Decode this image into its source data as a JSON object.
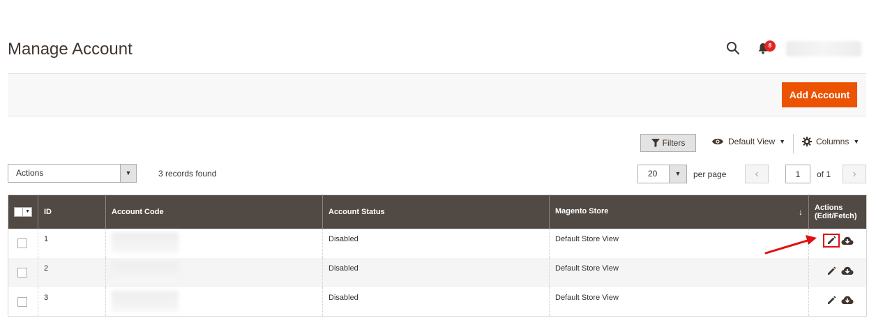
{
  "page": {
    "title": "Manage Account"
  },
  "header": {
    "notifications_count": "8",
    "search_icon": "search-icon",
    "bell_icon": "bell-icon"
  },
  "toolbar": {
    "add_button": "Add Account"
  },
  "grid_controls": {
    "filters_label": "Filters",
    "view_label": "Default View",
    "columns_label": "Columns",
    "actions_select": "Actions",
    "records_found": "3 records found",
    "page_size": "20",
    "per_page_label": "per page",
    "current_page": "1",
    "of_pages": "of 1"
  },
  "table": {
    "headers": {
      "id": "ID",
      "account_code": "Account Code",
      "account_status": "Account Status",
      "magento_store": "Magento Store",
      "actions_line1": "Actions",
      "actions_line2": "(Edit/Fetch)"
    },
    "rows": [
      {
        "id": "1",
        "status": "Disabled",
        "store": "Default Store View"
      },
      {
        "id": "2",
        "status": "Disabled",
        "store": "Default Store View"
      },
      {
        "id": "3",
        "status": "Disabled",
        "store": "Default Store View"
      }
    ]
  },
  "colors": {
    "accent": "#eb5202",
    "header_bg": "#514943",
    "highlight": "#e01010"
  }
}
